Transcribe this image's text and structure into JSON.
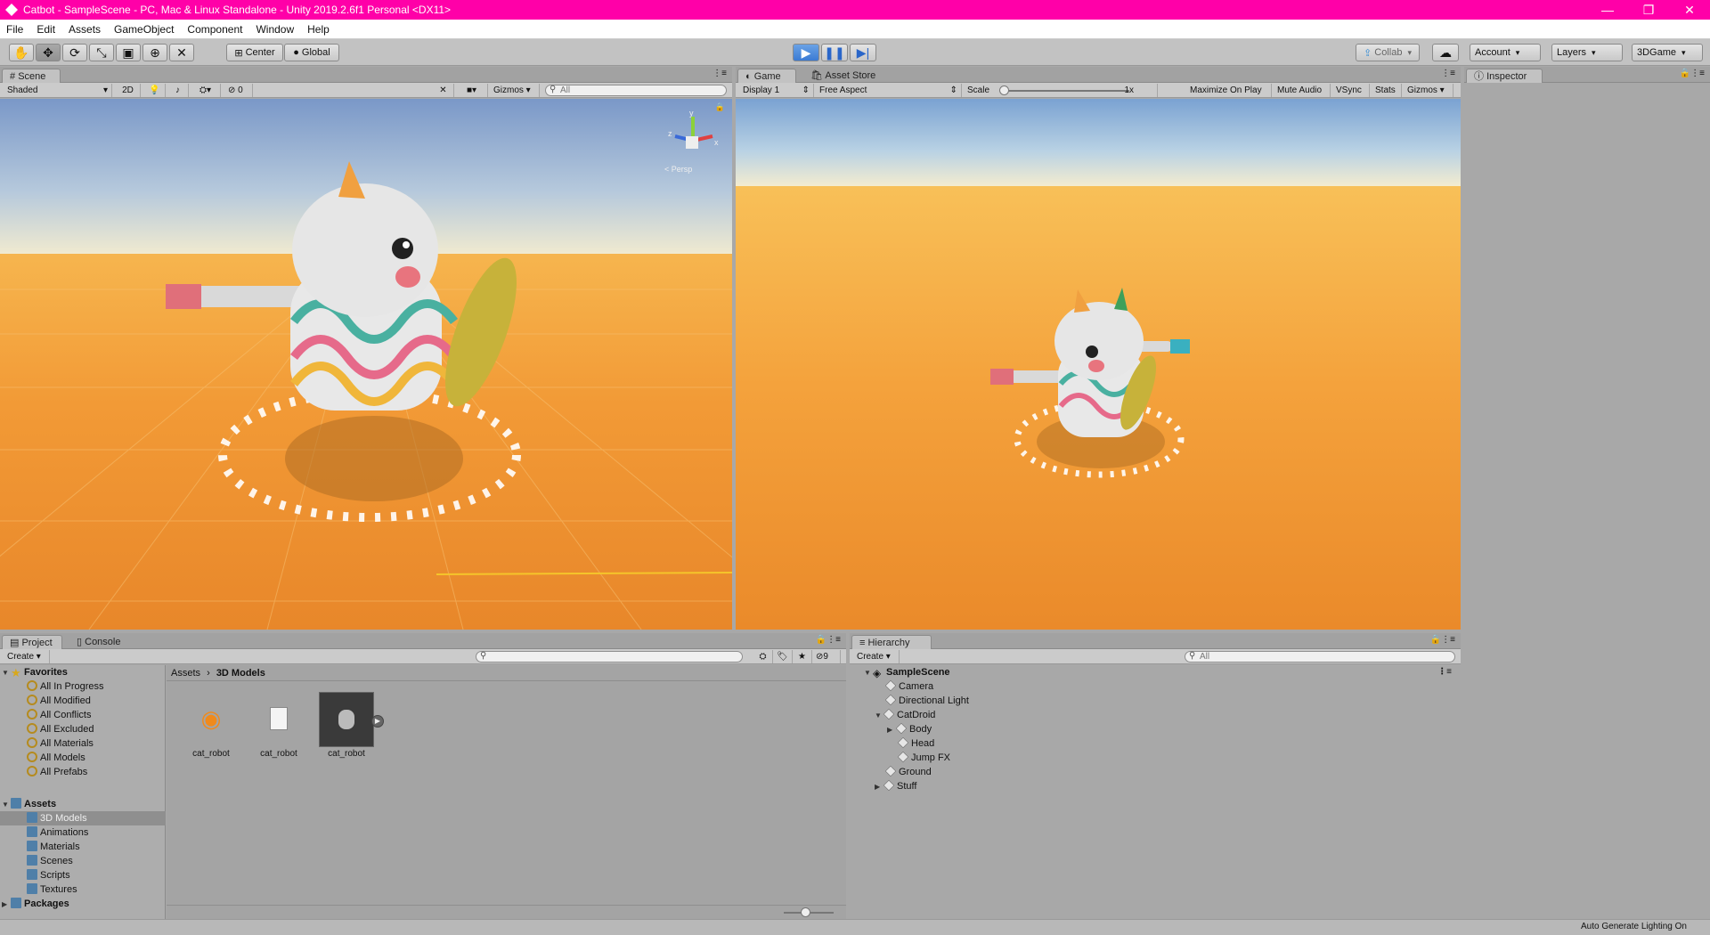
{
  "window": {
    "title": "Catbot - SampleScene - PC, Mac & Linux Standalone - Unity 2019.2.6f1 Personal <DX11>",
    "controls": [
      "—",
      "❐",
      "✕"
    ]
  },
  "menu": [
    "File",
    "Edit",
    "Assets",
    "GameObject",
    "Component",
    "Window",
    "Help"
  ],
  "toolbar": {
    "transform_tools": [
      "hand-icon",
      "move-icon",
      "rotate-icon",
      "scale-icon",
      "rect-icon",
      "transform-icon",
      "custom-tool-icon"
    ],
    "pivot_label": "Center",
    "space_label": "Global",
    "collab_label": "Collab",
    "account_label": "Account",
    "layers_label": "Layers",
    "layout_label": "3DGame"
  },
  "scene": {
    "tab_label": "Scene",
    "shading": "Shaded",
    "mode_2d": "2D",
    "hidden_count": "0",
    "gizmos": "Gizmos",
    "search_placeholder": "All",
    "persp_label": "< Persp",
    "axes": {
      "y": "y",
      "x": "x",
      "z": "z"
    }
  },
  "game": {
    "tab_label": "Game",
    "asset_store_label": "Asset Store",
    "display": "Display 1",
    "aspect": "Free Aspect",
    "scale_label": "Scale",
    "scale_value": "1x",
    "maximize": "Maximize On Play",
    "mute": "Mute Audio",
    "vsync": "VSync",
    "stats": "Stats",
    "gizmos": "Gizmos"
  },
  "inspector": {
    "tab_label": "Inspector"
  },
  "project": {
    "tab_label": "Project",
    "console_label": "Console",
    "create_label": "Create",
    "hidden_count": "9",
    "favorites_label": "Favorites",
    "favorites": [
      "All In Progress",
      "All Modified",
      "All Conflicts",
      "All Excluded",
      "All Materials",
      "All Models",
      "All Prefabs"
    ],
    "assets_label": "Assets",
    "asset_folders": [
      "3D Models",
      "Animations",
      "Materials",
      "Scenes",
      "Scripts",
      "Textures"
    ],
    "packages_label": "Packages",
    "breadcrumb": [
      "Assets",
      "3D Models"
    ],
    "files": [
      {
        "name": "cat_robot",
        "icon": "blender-icon"
      },
      {
        "name": "cat_robot",
        "icon": "document-icon"
      },
      {
        "name": "cat_robot",
        "icon": "model-preview-icon"
      }
    ]
  },
  "hierarchy": {
    "tab_label": "Hierarchy",
    "create_label": "Create",
    "search_placeholder": "All",
    "scene_name": "SampleScene",
    "items": [
      "Camera",
      "Directional Light",
      "CatDroid",
      "Body",
      "Head",
      "Jump FX",
      "Ground",
      "Stuff"
    ]
  },
  "status": {
    "right_text": "Auto Generate Lighting On"
  },
  "colors": {
    "title_bar": "#ff00a8",
    "play_active": "#3b7bd4",
    "selection": "#8f8f8f"
  }
}
